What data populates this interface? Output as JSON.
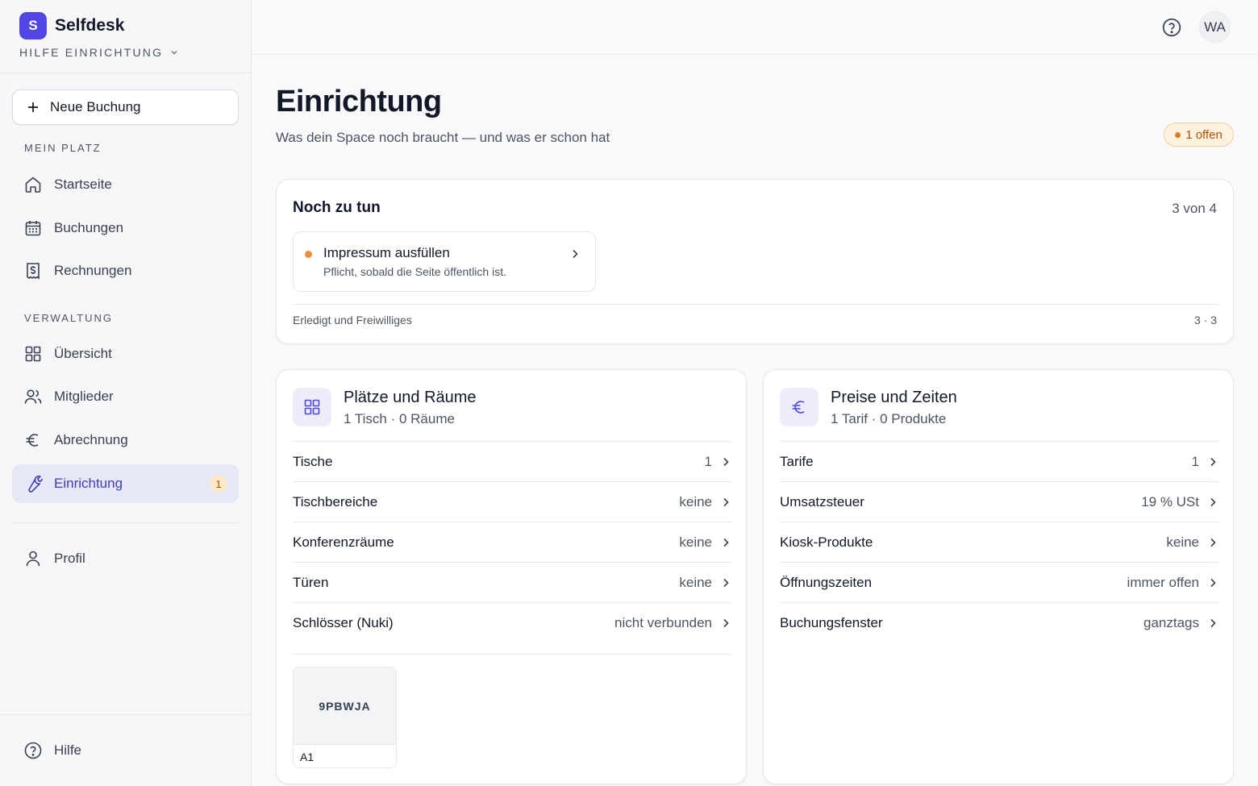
{
  "brand": {
    "logo_letter": "S",
    "name": "Selfdesk",
    "workspace": "HILFE EINRICHTUNG"
  },
  "sidebar": {
    "new_booking": "Neue Buchung",
    "section_mein_platz": "MEIN PLATZ",
    "section_verwaltung": "VERWALTUNG",
    "items": [
      {
        "label": "Startseite"
      },
      {
        "label": "Buchungen"
      },
      {
        "label": "Rechnungen"
      },
      {
        "label": "Übersicht"
      },
      {
        "label": "Mitglieder"
      },
      {
        "label": "Abrechnung"
      },
      {
        "label": "Einrichtung",
        "badge": "1",
        "active": true
      },
      {
        "label": "Profil"
      },
      {
        "label": "Hilfe"
      }
    ]
  },
  "topbar": {
    "avatar_initials": "WA"
  },
  "page": {
    "title": "Einrichtung",
    "subtitle": "Was dein Space noch braucht — und was er schon hat",
    "open_badge": "1 offen"
  },
  "todo": {
    "title": "Noch zu tun",
    "count": "3 von 4",
    "task": {
      "title": "Impressum ausfüllen",
      "description": "Pflicht, sobald die Seite öffentlich ist."
    },
    "footer_label": "Erledigt und Freiwilliges",
    "footer_count": "3 · 3"
  },
  "places": {
    "title": "Plätze und Räume",
    "subtitle": "1 Tisch · 0 Räume",
    "rows": [
      {
        "label": "Tische",
        "value": "1"
      },
      {
        "label": "Tischbereiche",
        "value": "keine"
      },
      {
        "label": "Konferenzräume",
        "value": "keine"
      },
      {
        "label": "Türen",
        "value": "keine"
      },
      {
        "label": "Schlösser (Nuki)",
        "value": "nicht verbunden"
      }
    ],
    "plan": {
      "code": "9PBWJA",
      "desk": "A1"
    }
  },
  "prices": {
    "title": "Preise und Zeiten",
    "subtitle": "1 Tarif · 0 Produkte",
    "rows": [
      {
        "label": "Tarife",
        "value": "1"
      },
      {
        "label": "Umsatzsteuer",
        "value": "19 % USt"
      },
      {
        "label": "Kiosk-Produkte",
        "value": "keine"
      },
      {
        "label": "Öffnungszeiten",
        "value": "immer offen"
      },
      {
        "label": "Buchungsfenster",
        "value": "ganztags"
      }
    ]
  },
  "colors": {
    "accent": "#4f46e5",
    "active_bg": "#e7e8f7",
    "warning": "#e07a1f"
  }
}
